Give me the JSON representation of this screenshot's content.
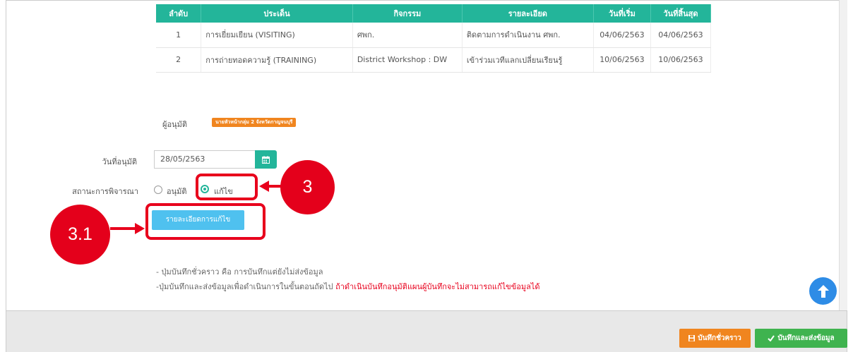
{
  "table": {
    "headers": [
      "ลำดับ",
      "ประเด็น",
      "กิจกรรม",
      "รายละเอียด",
      "วันที่เริ่ม",
      "วันที่สิ้นสุด"
    ],
    "rows": [
      [
        "1",
        "การเยี่ยมเยียน (VISITING)",
        "ศพก.",
        "ติดตามการดำเนินงาน ศพก.",
        "04/06/2563",
        "04/06/2563"
      ],
      [
        "2",
        "การถ่ายทอดความรู้ (TRAINING)",
        "District Workshop : DW",
        "เข้าร่วมเวทีแลกเปลี่ยนเรียนรู้",
        "10/06/2563",
        "10/06/2563"
      ]
    ]
  },
  "approver": {
    "label": "ผู้อนุมัติ",
    "badge": "นายหัวหน้ากลุ่ม 2 จังหวัดกาญจนบุรี"
  },
  "approval_date": {
    "label": "วันที่อนุมัติ",
    "value": "28/05/2563",
    "icon": "calendar-icon"
  },
  "status": {
    "label": "สถานะการพิจารณา",
    "options": [
      {
        "label": "อนุมัติ",
        "selected": false
      },
      {
        "label": "แก้ไข",
        "selected": true
      }
    ]
  },
  "detail_button": {
    "label": "รายละเอียดการแก้ไข"
  },
  "callouts": {
    "c3": "3",
    "c31": "3.1"
  },
  "notes": {
    "line1": "- ปุ่มบันทึกชั่วคราว คือ การบันทึกแต่ยังไม่ส่งข้อมูล",
    "line2_prefix": "-ปุ่มบันทึกและส่งข้อมูลเพื่อดำเนินการในขั้นตอนถัดไป ",
    "line2_warning": "ถ้าดำเนินบันทึกอนุมัติแผนผู้บันทึกจะไม่สามารถแก้ไขข้อมูลได้"
  },
  "footer": {
    "save_draft": "บันทึกชั่วคราว",
    "save_send": "บันทึกและส่งข้อมูล"
  },
  "colors": {
    "accent": "#23b59a",
    "warning": "#f0851f",
    "success": "#3fb34f",
    "annotation": "#e8001c"
  }
}
